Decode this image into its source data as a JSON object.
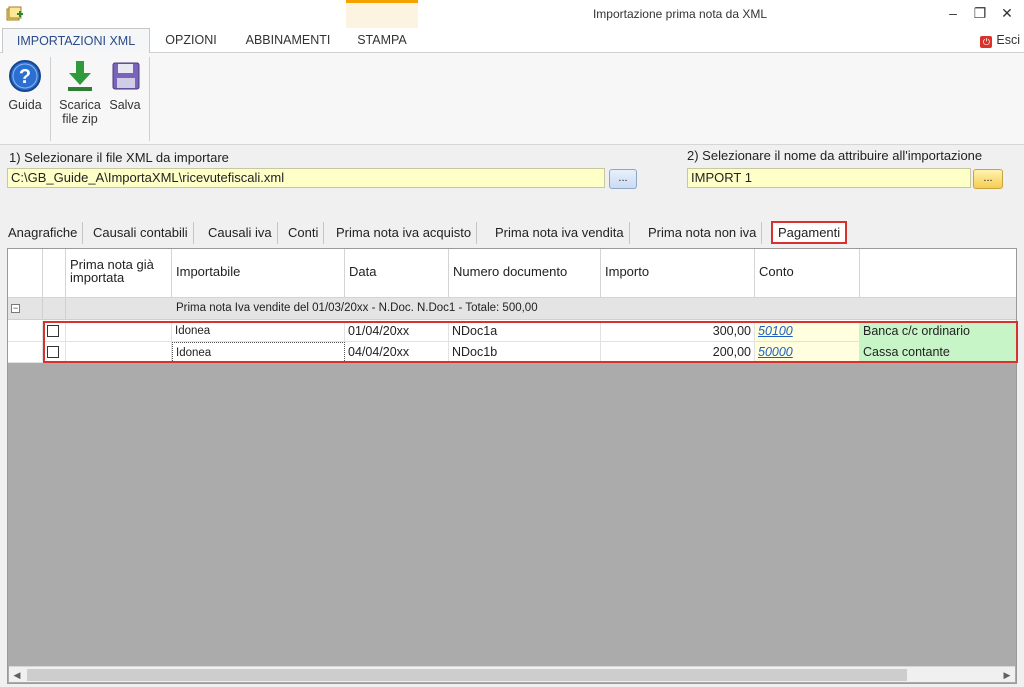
{
  "window": {
    "title": "Importazione prima nota da XML",
    "minimize": "–",
    "restore": "❐",
    "close": "✕"
  },
  "ribbon": {
    "tabs": [
      "IMPORTAZIONI XML",
      "OPZIONI",
      "ABBINAMENTI",
      "STAMPA"
    ],
    "exit_label": "Esci",
    "buttons": {
      "guida": "Guida",
      "scarica_line1": "Scarica",
      "scarica_line2": "file zip",
      "salva": "Salva"
    }
  },
  "selectors": {
    "file_label": "1) Selezionare il file XML da importare",
    "file_value": "C:\\GB_Guide_A\\ImportaXML\\ricevutefiscali.xml",
    "name_label": "2) Selezionare il nome da attribuire all'importazione",
    "name_value": "IMPORT 1",
    "browse": "..."
  },
  "tabs": [
    "Anagrafiche",
    "Causali contabili",
    "Causali iva",
    "Conti",
    "Prima nota iva acquisto",
    "Prima nota iva vendita",
    "Prima nota non iva",
    "Pagamenti"
  ],
  "grid": {
    "headers": {
      "prima_nota_line1": "Prima nota già",
      "prima_nota_line2": "importata",
      "importabile": "Importabile",
      "data": "Data",
      "numero": "Numero documento",
      "importo": "Importo",
      "conto": "Conto"
    },
    "group": {
      "expander": "−",
      "text": "Prima nota Iva vendite del 01/03/20xx - N.Doc. N.Doc1 - Totale: 500,00"
    },
    "rows": [
      {
        "importabile": "Idonea",
        "data": "01/04/20xx",
        "numero": "NDoc1a",
        "importo": "300,00",
        "conto": "50100",
        "descrizione": "Banca c/c ordinario"
      },
      {
        "importabile": "Idonea",
        "data": "04/04/20xx",
        "numero": "NDoc1b",
        "importo": "200,00",
        "conto": "50000",
        "descrizione": "Cassa contante"
      }
    ]
  },
  "colors": {
    "accent_tab": "#2b4a8a",
    "highlight": "#d93030",
    "stampa_top": "#f5a200",
    "green_cell": "#c8f5c8"
  }
}
